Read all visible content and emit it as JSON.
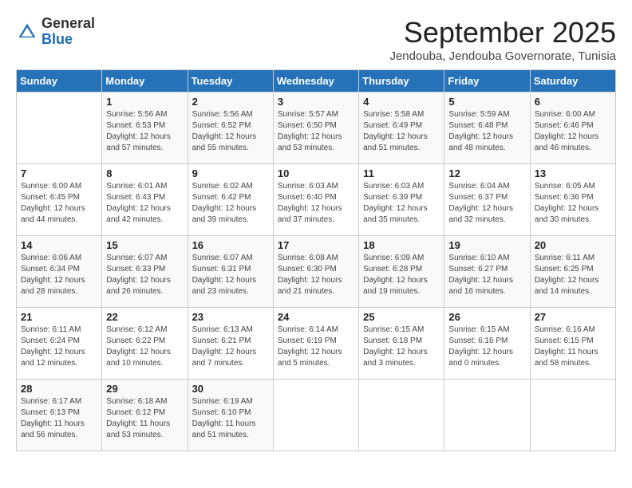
{
  "header": {
    "logo_general": "General",
    "logo_blue": "Blue",
    "month": "September 2025",
    "location": "Jendouba, Jendouba Governorate, Tunisia"
  },
  "days_of_week": [
    "Sunday",
    "Monday",
    "Tuesday",
    "Wednesday",
    "Thursday",
    "Friday",
    "Saturday"
  ],
  "weeks": [
    [
      {
        "day": "",
        "sunrise": "",
        "sunset": "",
        "daylight": ""
      },
      {
        "day": "1",
        "sunrise": "Sunrise: 5:56 AM",
        "sunset": "Sunset: 6:53 PM",
        "daylight": "Daylight: 12 hours and 57 minutes."
      },
      {
        "day": "2",
        "sunrise": "Sunrise: 5:56 AM",
        "sunset": "Sunset: 6:52 PM",
        "daylight": "Daylight: 12 hours and 55 minutes."
      },
      {
        "day": "3",
        "sunrise": "Sunrise: 5:57 AM",
        "sunset": "Sunset: 6:50 PM",
        "daylight": "Daylight: 12 hours and 53 minutes."
      },
      {
        "day": "4",
        "sunrise": "Sunrise: 5:58 AM",
        "sunset": "Sunset: 6:49 PM",
        "daylight": "Daylight: 12 hours and 51 minutes."
      },
      {
        "day": "5",
        "sunrise": "Sunrise: 5:59 AM",
        "sunset": "Sunset: 6:48 PM",
        "daylight": "Daylight: 12 hours and 48 minutes."
      },
      {
        "day": "6",
        "sunrise": "Sunrise: 6:00 AM",
        "sunset": "Sunset: 6:46 PM",
        "daylight": "Daylight: 12 hours and 46 minutes."
      }
    ],
    [
      {
        "day": "7",
        "sunrise": "Sunrise: 6:00 AM",
        "sunset": "Sunset: 6:45 PM",
        "daylight": "Daylight: 12 hours and 44 minutes."
      },
      {
        "day": "8",
        "sunrise": "Sunrise: 6:01 AM",
        "sunset": "Sunset: 6:43 PM",
        "daylight": "Daylight: 12 hours and 42 minutes."
      },
      {
        "day": "9",
        "sunrise": "Sunrise: 6:02 AM",
        "sunset": "Sunset: 6:42 PM",
        "daylight": "Daylight: 12 hours and 39 minutes."
      },
      {
        "day": "10",
        "sunrise": "Sunrise: 6:03 AM",
        "sunset": "Sunset: 6:40 PM",
        "daylight": "Daylight: 12 hours and 37 minutes."
      },
      {
        "day": "11",
        "sunrise": "Sunrise: 6:03 AM",
        "sunset": "Sunset: 6:39 PM",
        "daylight": "Daylight: 12 hours and 35 minutes."
      },
      {
        "day": "12",
        "sunrise": "Sunrise: 6:04 AM",
        "sunset": "Sunset: 6:37 PM",
        "daylight": "Daylight: 12 hours and 32 minutes."
      },
      {
        "day": "13",
        "sunrise": "Sunrise: 6:05 AM",
        "sunset": "Sunset: 6:36 PM",
        "daylight": "Daylight: 12 hours and 30 minutes."
      }
    ],
    [
      {
        "day": "14",
        "sunrise": "Sunrise: 6:06 AM",
        "sunset": "Sunset: 6:34 PM",
        "daylight": "Daylight: 12 hours and 28 minutes."
      },
      {
        "day": "15",
        "sunrise": "Sunrise: 6:07 AM",
        "sunset": "Sunset: 6:33 PM",
        "daylight": "Daylight: 12 hours and 26 minutes."
      },
      {
        "day": "16",
        "sunrise": "Sunrise: 6:07 AM",
        "sunset": "Sunset: 6:31 PM",
        "daylight": "Daylight: 12 hours and 23 minutes."
      },
      {
        "day": "17",
        "sunrise": "Sunrise: 6:08 AM",
        "sunset": "Sunset: 6:30 PM",
        "daylight": "Daylight: 12 hours and 21 minutes."
      },
      {
        "day": "18",
        "sunrise": "Sunrise: 6:09 AM",
        "sunset": "Sunset: 6:28 PM",
        "daylight": "Daylight: 12 hours and 19 minutes."
      },
      {
        "day": "19",
        "sunrise": "Sunrise: 6:10 AM",
        "sunset": "Sunset: 6:27 PM",
        "daylight": "Daylight: 12 hours and 16 minutes."
      },
      {
        "day": "20",
        "sunrise": "Sunrise: 6:11 AM",
        "sunset": "Sunset: 6:25 PM",
        "daylight": "Daylight: 12 hours and 14 minutes."
      }
    ],
    [
      {
        "day": "21",
        "sunrise": "Sunrise: 6:11 AM",
        "sunset": "Sunset: 6:24 PM",
        "daylight": "Daylight: 12 hours and 12 minutes."
      },
      {
        "day": "22",
        "sunrise": "Sunrise: 6:12 AM",
        "sunset": "Sunset: 6:22 PM",
        "daylight": "Daylight: 12 hours and 10 minutes."
      },
      {
        "day": "23",
        "sunrise": "Sunrise: 6:13 AM",
        "sunset": "Sunset: 6:21 PM",
        "daylight": "Daylight: 12 hours and 7 minutes."
      },
      {
        "day": "24",
        "sunrise": "Sunrise: 6:14 AM",
        "sunset": "Sunset: 6:19 PM",
        "daylight": "Daylight: 12 hours and 5 minutes."
      },
      {
        "day": "25",
        "sunrise": "Sunrise: 6:15 AM",
        "sunset": "Sunset: 6:18 PM",
        "daylight": "Daylight: 12 hours and 3 minutes."
      },
      {
        "day": "26",
        "sunrise": "Sunrise: 6:15 AM",
        "sunset": "Sunset: 6:16 PM",
        "daylight": "Daylight: 12 hours and 0 minutes."
      },
      {
        "day": "27",
        "sunrise": "Sunrise: 6:16 AM",
        "sunset": "Sunset: 6:15 PM",
        "daylight": "Daylight: 11 hours and 58 minutes."
      }
    ],
    [
      {
        "day": "28",
        "sunrise": "Sunrise: 6:17 AM",
        "sunset": "Sunset: 6:13 PM",
        "daylight": "Daylight: 11 hours and 56 minutes."
      },
      {
        "day": "29",
        "sunrise": "Sunrise: 6:18 AM",
        "sunset": "Sunset: 6:12 PM",
        "daylight": "Daylight: 11 hours and 53 minutes."
      },
      {
        "day": "30",
        "sunrise": "Sunrise: 6:19 AM",
        "sunset": "Sunset: 6:10 PM",
        "daylight": "Daylight: 11 hours and 51 minutes."
      },
      {
        "day": "",
        "sunrise": "",
        "sunset": "",
        "daylight": ""
      },
      {
        "day": "",
        "sunrise": "",
        "sunset": "",
        "daylight": ""
      },
      {
        "day": "",
        "sunrise": "",
        "sunset": "",
        "daylight": ""
      },
      {
        "day": "",
        "sunrise": "",
        "sunset": "",
        "daylight": ""
      }
    ]
  ]
}
